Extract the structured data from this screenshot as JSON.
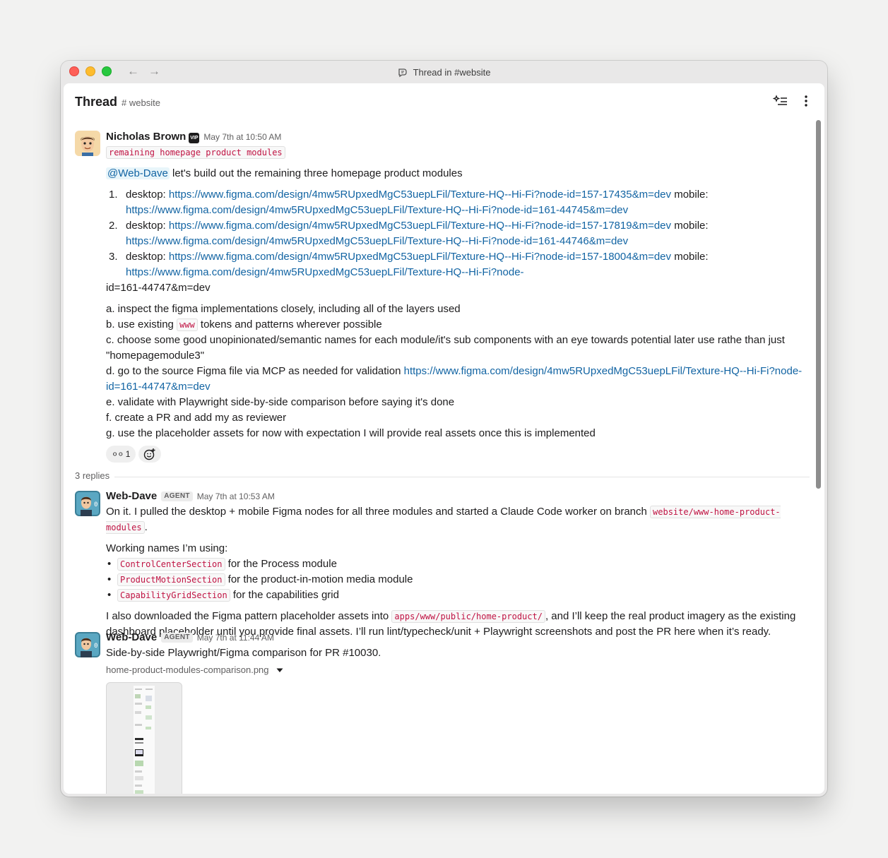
{
  "window": {
    "title": "Thread in #website"
  },
  "header": {
    "title": "Thread",
    "channel": "# website"
  },
  "root": {
    "author": "Nicholas Brown",
    "badge": "VIP",
    "time": "May 7th at 10:50 AM",
    "tag": "remaining homepage product modules",
    "mention": "@Web-Dave",
    "intro": " let's build out the remaining three homepage product modules",
    "items": [
      {
        "num": "1.",
        "desktop_label": "desktop: ",
        "desktop_url": "https://www.figma.com/design/4mw5RUpxedMgC53uepLFil/Texture-HQ--Hi-Fi?node-id=157-17435&m=dev",
        "mobile_label": " mobile:",
        "mobile_url": "https://www.figma.com/design/4mw5RUpxedMgC53uepLFil/Texture-HQ--Hi-Fi?node-id=161-44745&m=dev"
      },
      {
        "num": "2.",
        "desktop_label": "desktop: ",
        "desktop_url": "https://www.figma.com/design/4mw5RUpxedMgC53uepLFil/Texture-HQ--Hi-Fi?node-id=157-17819&m=dev",
        "mobile_label": " mobile:",
        "mobile_url": "https://www.figma.com/design/4mw5RUpxedMgC53uepLFil/Texture-HQ--Hi-Fi?node-id=161-44746&m=dev"
      },
      {
        "num": "3.",
        "desktop_label": "desktop: ",
        "desktop_url": "https://www.figma.com/design/4mw5RUpxedMgC53uepLFil/Texture-HQ--Hi-Fi?node-id=157-18004&m=dev",
        "mobile_label": " mobile:",
        "mobile_url": "https://www.figma.com/design/4mw5RUpxedMgC53uepLFil/Texture-HQ--Hi-Fi?node-"
      }
    ],
    "item3_tail": "id=161-44747&m=dev",
    "step_a": "a. inspect the figma implementations closely, including all of the layers used",
    "step_b_pre": "b. use existing ",
    "step_b_code": "www",
    "step_b_post": " tokens and patterns wherever possible",
    "step_c": "c. choose some good unopinionated/semantic names for each module/it's sub components with an eye towards potential later use rathe than just \"homepagemodule3\"",
    "step_d_pre": "d. go to the source Figma file via MCP as needed for validation ",
    "step_d_url": "https://www.figma.com/design/4mw5RUpxedMgC53uepLFil/Texture-HQ--Hi-Fi?node-id=161-44747&m=dev",
    "step_e": "e. validate with Playwright side-by-side comparison before saying it's done",
    "step_f": "f. create a PR and add my as reviewer",
    "step_g": "g. use the placeholder assets for now with expectation I will provide real assets once this is implemented",
    "reaction_count": "1"
  },
  "replies_label": "3 replies",
  "reply1": {
    "author": "Web-Dave",
    "badge": "AGENT",
    "time": "May 7th at 10:53 AM",
    "line1_pre": "On it. I pulled the desktop + mobile Figma nodes for all three modules and started a Claude Code worker on branch ",
    "line1_code": "website/www-home-product-modules",
    "line1_post": ".",
    "names_intro": "Working names I’m using:",
    "names": [
      {
        "code": "ControlCenterSection",
        "text": " for the Process module"
      },
      {
        "code": "ProductMotionSection",
        "text": " for the product-in-motion media module"
      },
      {
        "code": "CapabilityGridSection",
        "text": " for the capabilities grid"
      }
    ],
    "para_pre": "I also downloaded the Figma pattern placeholder assets into ",
    "para_code": "apps/www/public/home-product/",
    "para_post": ", and I’ll keep the real product imagery as the existing dashboard placeholder until you provide final assets. I’ll run lint/typecheck/unit + Playwright screenshots and post the PR here when it’s ready."
  },
  "reply2": {
    "author": "Web-Dave",
    "badge": "AGENT",
    "time": "May 7th at 11:44 AM",
    "text": "Side-by-side Playwright/Figma comparison for PR #10030.",
    "file_name": "home-product-modules-comparison.png"
  }
}
